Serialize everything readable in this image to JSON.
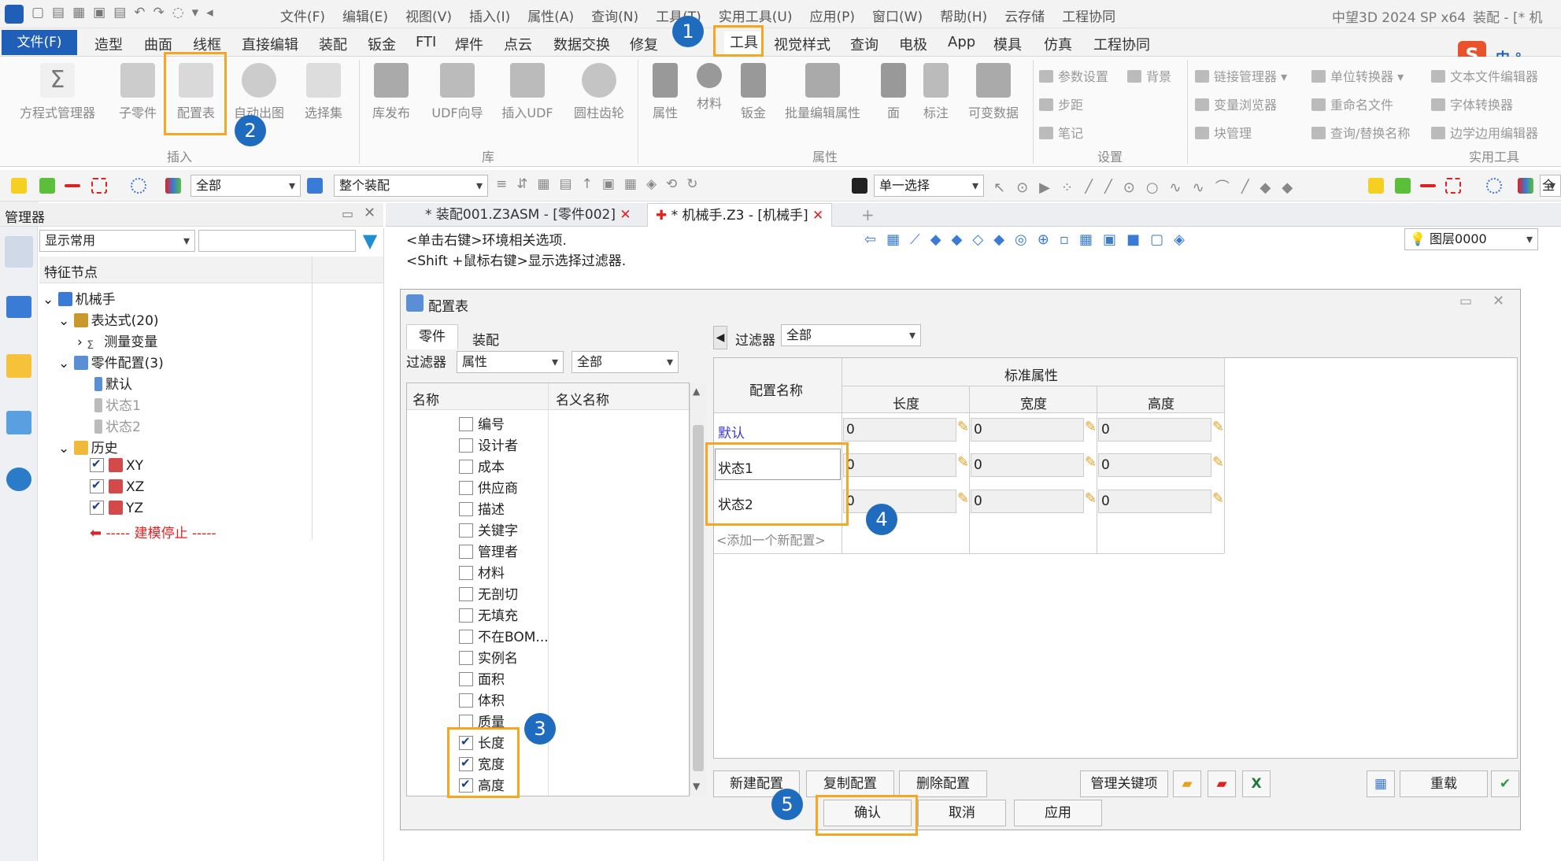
{
  "menubar": [
    "文件(F)",
    "编辑(E)",
    "视图(V)",
    "插入(I)",
    "属性(A)",
    "查询(N)",
    "工具(T)",
    "实用工具(U)",
    "应用(P)",
    "窗口(W)",
    "帮助(H)",
    "云存储",
    "工程协同"
  ],
  "app_title": "中望3D 2024 SP x64",
  "window_title": "装配 - [* 机",
  "file_tab": "文件(F)",
  "ribbon_tabs": [
    "造型",
    "曲面",
    "线框",
    "直接编辑",
    "装配",
    "钣金",
    "FTI",
    "焊件",
    "点云",
    "数据交换",
    "修复",
    "",
    "工具",
    "视觉样式",
    "查询",
    "电极",
    "App",
    "模具",
    "仿真",
    "工程协同"
  ],
  "ribbon": {
    "insert_buttons": [
      "方程式管理器",
      "子零件",
      "配置表",
      "自动出图",
      "选择集"
    ],
    "lib_buttons": [
      "库发布",
      "UDF向导",
      "插入UDF",
      "圆柱齿轮"
    ],
    "attr_buttons": [
      "属性",
      "材料",
      "钣金",
      "批量编辑属性",
      "面",
      "标注",
      "可变数据"
    ],
    "settings_items": [
      "参数设置",
      "背景",
      "步距",
      "笔记"
    ],
    "util_items": [
      "链接管理器",
      "单位转换器",
      "文本文件编辑器",
      "变量浏览器",
      "重命名文件",
      "字体转换器",
      "块管理",
      "查询/替换名称",
      "边学边用编辑器"
    ],
    "groups": [
      "插入",
      "库",
      "属性",
      "设置",
      "实用工具"
    ]
  },
  "toolbar": {
    "filter1": "全部",
    "filter2": "整个装配",
    "select_mode": "单一选择",
    "layer": "图层0000",
    "filter3": "全"
  },
  "manager": {
    "title": "管理器",
    "display": "显示常用",
    "col_header": "特征节点",
    "tree": [
      "机械手",
      "表达式(20)",
      "测量变量",
      "零件配置(3)",
      "默认",
      "状态1",
      "状态2",
      "历史",
      "XY",
      "XZ",
      "YZ",
      "----- 建模停止 -----"
    ]
  },
  "doc_tabs": [
    "* 装配001.Z3ASM - [零件002]",
    "* 机械手.Z3 - [机械手]"
  ],
  "hints": [
    "<单击右键>环境相关选项.",
    "<Shift +鼠标右键>显示选择过滤器."
  ],
  "dialog": {
    "title": "配置表",
    "tabs": [
      "零件",
      "装配"
    ],
    "filter_label": "过滤器",
    "filter_type": "属性",
    "filter_value": "全部",
    "col_name": "名称",
    "col_alias": "名义名称",
    "props": [
      {
        "label": "编号",
        "checked": false
      },
      {
        "label": "设计者",
        "checked": false
      },
      {
        "label": "成本",
        "checked": false
      },
      {
        "label": "供应商",
        "checked": false
      },
      {
        "label": "描述",
        "checked": false
      },
      {
        "label": "关键字",
        "checked": false
      },
      {
        "label": "管理者",
        "checked": false
      },
      {
        "label": "材料",
        "checked": false
      },
      {
        "label": "无剖切",
        "checked": false
      },
      {
        "label": "无填充",
        "checked": false
      },
      {
        "label": "不在BOM...",
        "checked": false
      },
      {
        "label": "实例名",
        "checked": false
      },
      {
        "label": "面积",
        "checked": false
      },
      {
        "label": "体积",
        "checked": false
      },
      {
        "label": "质量",
        "checked": false
      },
      {
        "label": "长度",
        "checked": true
      },
      {
        "label": "宽度",
        "checked": true
      },
      {
        "label": "高度",
        "checked": true
      }
    ],
    "right_filter_label": "过滤器",
    "right_filter": "全部",
    "grid": {
      "config_header": "配置名称",
      "group_header": "标准属性",
      "cols": [
        "长度",
        "宽度",
        "高度"
      ],
      "rows": [
        {
          "name": "默认",
          "vals": [
            "0",
            "0",
            "0"
          ]
        },
        {
          "name": "状态1",
          "vals": [
            "0",
            "0",
            "0"
          ]
        },
        {
          "name": "状态2",
          "vals": [
            "0",
            "0",
            "0"
          ]
        }
      ],
      "add_row": "<添加一个新配置>"
    },
    "buttons": {
      "new": "新建配置",
      "copy": "复制配置",
      "delete": "删除配置",
      "manage_keys": "管理关键项",
      "reload": "重载",
      "ok": "确认",
      "cancel": "取消",
      "apply": "应用"
    }
  },
  "badges": [
    "1",
    "2",
    "3",
    "4",
    "5"
  ],
  "colors": {
    "accent": "#1f5fb7",
    "highlight": "#f5a623",
    "badge": "#1f6cbf"
  }
}
